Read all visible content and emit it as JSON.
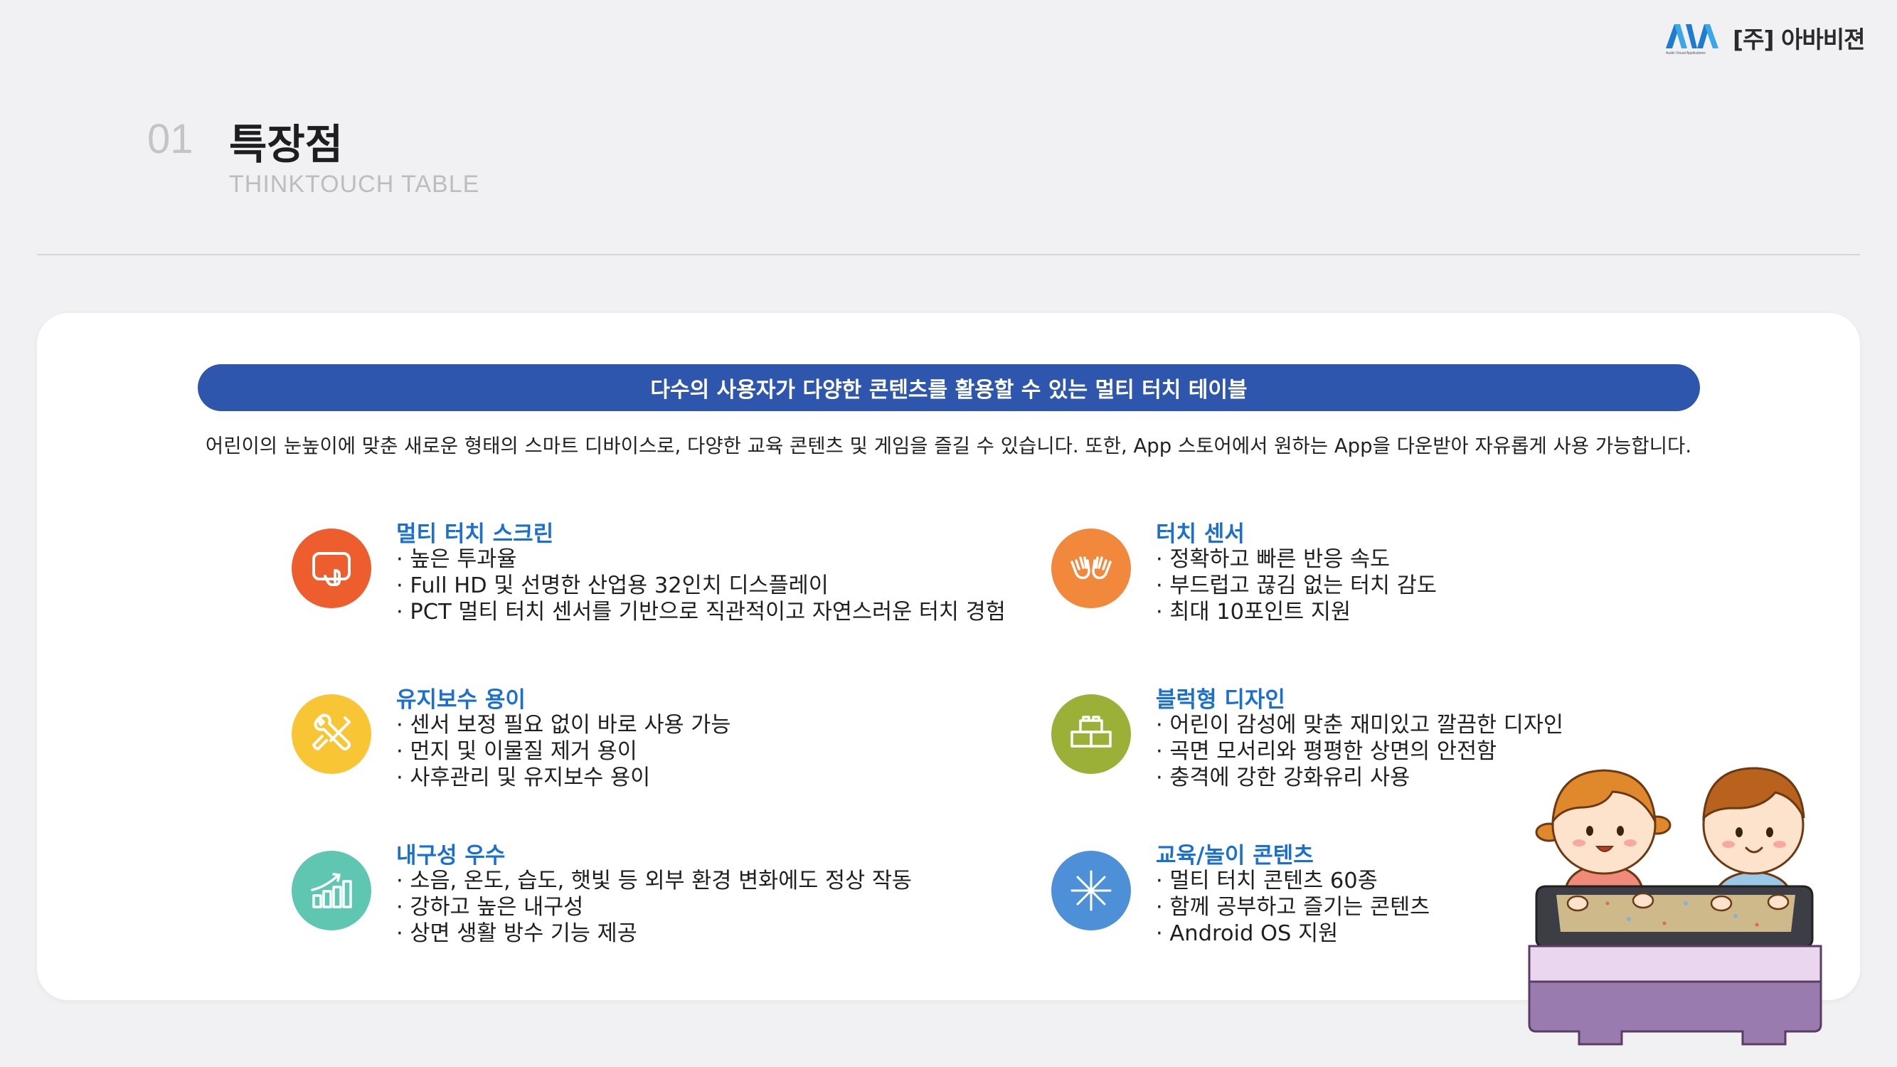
{
  "header": {
    "logo_mark_text": "AVA",
    "logo_tagline": "Audio Visual Applications",
    "company": "[주] 아바비젼"
  },
  "section": {
    "number": "01",
    "title": "특장점",
    "subtitle": "THINKTOUCH TABLE"
  },
  "banner": "다수의 사용자가 다양한 콘텐츠를 활용할 수 있는 멀티 터치 테이블",
  "intro": "어린이의 눈높이에 맞춘 새로운 형태의 스마트 디바이스로, 다양한 교육 콘텐츠 및 게임을 즐길 수 있습니다. 또한, App 스토어에서 원하는 App을 다운받아 자유롭게 사용 가능합니다.",
  "features": [
    {
      "title": "멀티 터치 스크린",
      "icon": "touch-screen-icon",
      "color": "#ee5d2d",
      "items": [
        "높은 투과율",
        "Full HD 및 선명한 산업용 32인치 디스플레이",
        "PCT 멀티 터치 센서를 기반으로 직관적이고 자연스러운 터치 경험"
      ]
    },
    {
      "title": "터치 센서",
      "icon": "hands-icon",
      "color": "#f2883b",
      "items": [
        "정확하고 빠른 반응 속도",
        "부드럽고 끊김 없는 터치 감도",
        "최대 10포인트 지원"
      ]
    },
    {
      "title": "유지보수 용이",
      "icon": "tools-icon",
      "color": "#f8c534",
      "items": [
        "센서 보정 필요 없이 바로 사용 가능",
        "먼지 및 이물질 제거 용이",
        "사후관리 및 유지보수 용이"
      ]
    },
    {
      "title": "블럭형 디자인",
      "icon": "blocks-icon",
      "color": "#9bb036",
      "items": [
        "어린이 감성에 맞춘 재미있고 깔끔한 디자인",
        "곡면 모서리와 평평한 상면의 안전함",
        "충격에 강한 강화유리 사용"
      ]
    },
    {
      "title": "내구성 우수",
      "icon": "growth-chart-icon",
      "color": "#5fc6b2",
      "items": [
        "소음, 온도, 습도, 햇빛 등 외부 환경 변화에도 정상 작동",
        "강하고 높은 내구성",
        "상면 생활 방수 기능 제공"
      ]
    },
    {
      "title": "교육/놀이 콘텐츠",
      "icon": "asterisk-icon",
      "color": "#4e90d8",
      "items": [
        "멀티 터치 콘텐츠 60종",
        "함께 공부하고 즐기는 콘텐츠",
        "Android OS 지원"
      ]
    }
  ],
  "illustration": "children-at-touch-table-illustration"
}
